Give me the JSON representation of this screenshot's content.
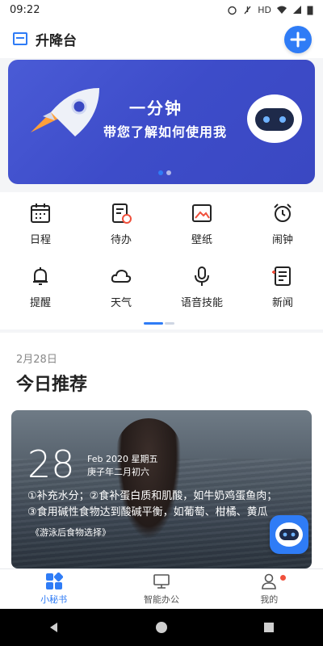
{
  "status": {
    "time": "09:22",
    "indicators": "HD"
  },
  "header": {
    "title": "升降台",
    "add_icon": "plus-icon"
  },
  "banner": {
    "title": "一分钟",
    "subtitle": "带您了解如何使用我",
    "slides": 2,
    "active": 1
  },
  "shortcuts": [
    {
      "label": "日程",
      "icon": "calendar-icon"
    },
    {
      "label": "待办",
      "icon": "todo-icon"
    },
    {
      "label": "壁纸",
      "icon": "wallpaper-icon"
    },
    {
      "label": "闹钟",
      "icon": "alarm-icon"
    },
    {
      "label": "提醒",
      "icon": "bell-icon"
    },
    {
      "label": "天气",
      "icon": "cloud-icon"
    },
    {
      "label": "语音技能",
      "icon": "microphone-icon"
    },
    {
      "label": "新闻",
      "icon": "news-icon"
    }
  ],
  "recommend": {
    "date": "2月28日",
    "title": "今日推荐",
    "card": {
      "day": "28",
      "month_week": "Feb 2020 星期五",
      "lunar": "庚子年二月初六",
      "line1": "①补充水分；②食补蛋白质和肌酸，如牛奶鸡蛋鱼肉；",
      "line2": "③食用碱性食物达到酸碱平衡，如葡萄、柑橘、黄瓜",
      "source": "《游泳后食物选择》"
    }
  },
  "tabs": [
    {
      "label": "小秘书",
      "icon": "assistant-icon",
      "active": true
    },
    {
      "label": "智能办公",
      "icon": "monitor-icon",
      "active": false
    },
    {
      "label": "我的",
      "icon": "user-icon",
      "active": false,
      "badge": true
    }
  ],
  "colors": {
    "accent": "#2f7cf6",
    "banner": "#4253cf",
    "badge": "#f0503c"
  }
}
